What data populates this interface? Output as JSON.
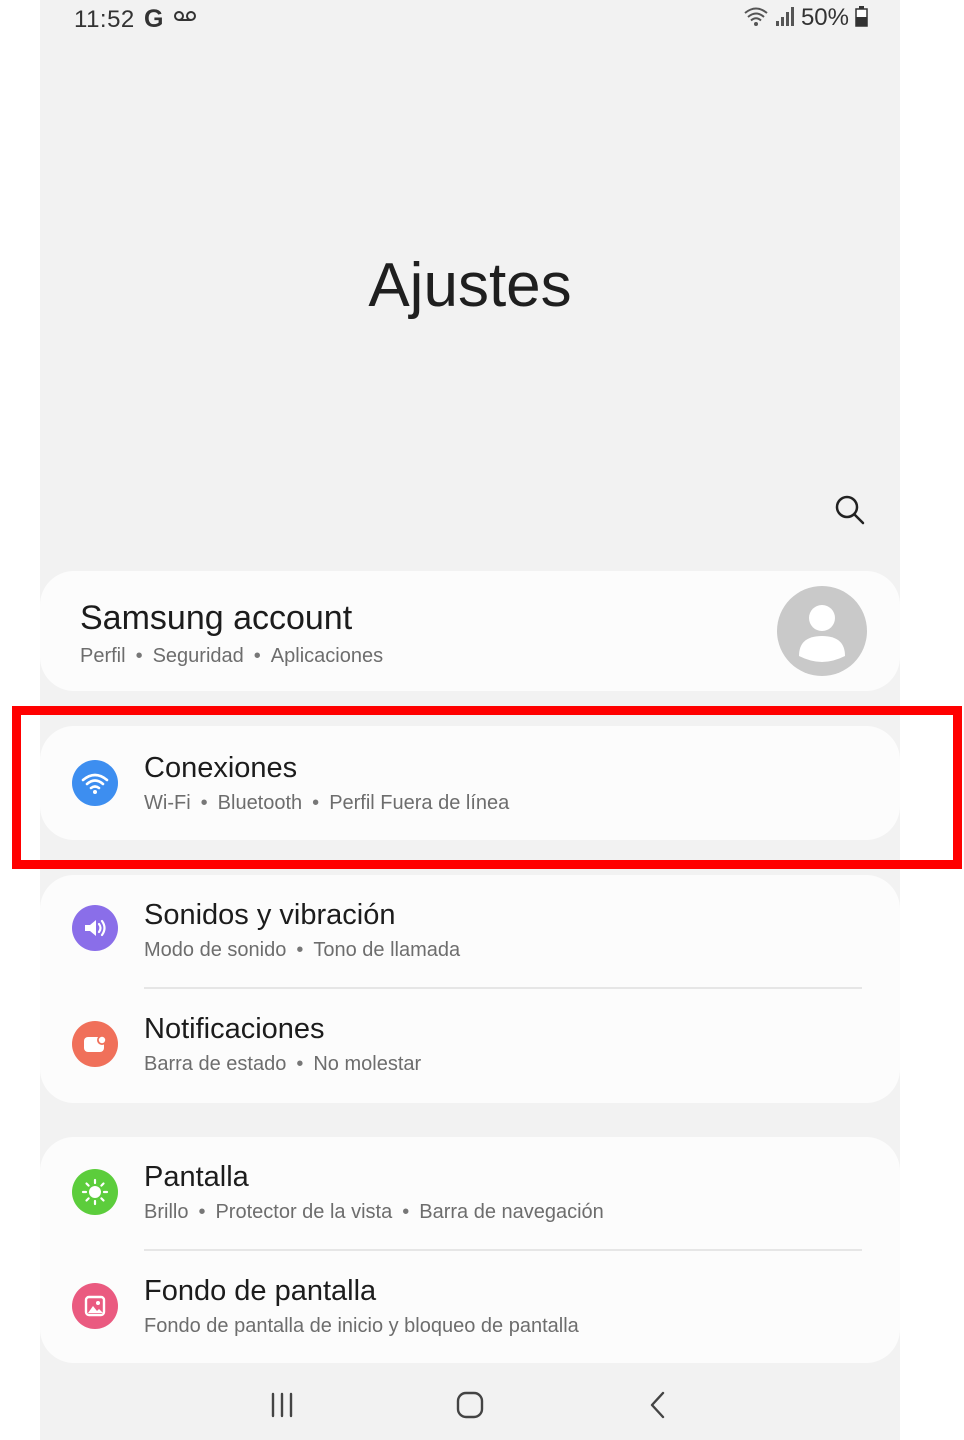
{
  "status_bar": {
    "time": "11:52",
    "g_label": "G",
    "battery": "50%",
    "icons": [
      "voicemail-icon",
      "wifi-icon",
      "signal-icon",
      "battery-icon"
    ]
  },
  "page_title": "Ajustes",
  "search": {
    "icon": "search-icon"
  },
  "account": {
    "title": "Samsung account",
    "sub": [
      "Perfil",
      "Seguridad",
      "Aplicaciones"
    ],
    "avatar_icon": "user-avatar-icon"
  },
  "items": [
    {
      "title": "Conexiones",
      "sub": [
        "Wi-Fi",
        "Bluetooth",
        "Perfil Fuera de línea"
      ],
      "icon": "wifi-icon",
      "color": "#3d8ef0"
    },
    {
      "title": "Sonidos y vibración",
      "sub": [
        "Modo de sonido",
        "Tono de llamada"
      ],
      "icon": "speaker-icon",
      "color": "#8a6ee9"
    },
    {
      "title": "Notificaciones",
      "sub": [
        "Barra de estado",
        "No molestar"
      ],
      "icon": "notification-icon",
      "color": "#f0705a"
    },
    {
      "title": "Pantalla",
      "sub": [
        "Brillo",
        "Protector de la vista",
        "Barra de navegación"
      ],
      "icon": "sun-icon",
      "color": "#5ccd3c"
    },
    {
      "title": "Fondo de pantalla",
      "sub": [
        "Fondo de pantalla de inicio y bloqueo de pantalla"
      ],
      "icon": "image-icon",
      "color": "#ea5a80"
    }
  ],
  "highlight_color": "#ff0000",
  "navbar": {
    "icons": [
      "recents-icon",
      "home-icon",
      "back-icon"
    ]
  }
}
